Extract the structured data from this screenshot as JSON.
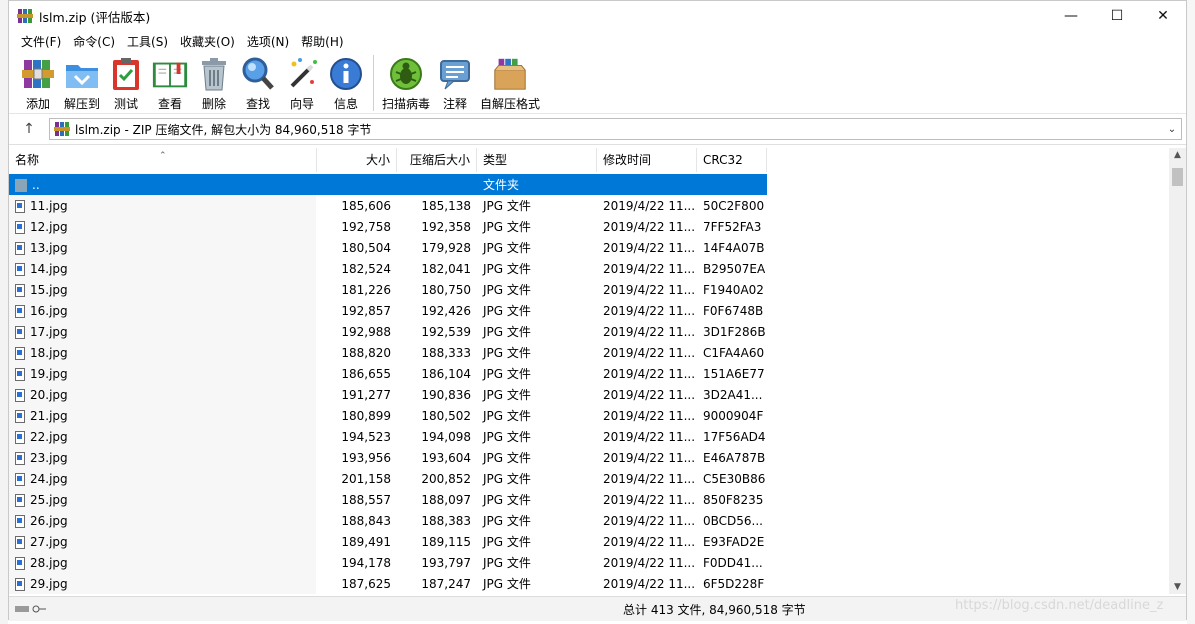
{
  "title": "lslm.zip (评估版本)",
  "window_controls": [
    "—",
    "☐",
    "✕"
  ],
  "menu": [
    "文件(F)",
    "命令(C)",
    "工具(S)",
    "收藏夹(O)",
    "选项(N)",
    "帮助(H)"
  ],
  "toolbar": [
    {
      "label": "添加",
      "icon": "add-archive-icon"
    },
    {
      "label": "解压到",
      "icon": "extract-folder-icon"
    },
    {
      "label": "测试",
      "icon": "test-clipboard-icon"
    },
    {
      "label": "查看",
      "icon": "view-book-icon"
    },
    {
      "label": "删除",
      "icon": "trash-icon"
    },
    {
      "label": "查找",
      "icon": "magnifier-icon"
    },
    {
      "label": "向导",
      "icon": "wizard-wand-icon"
    },
    {
      "label": "信息",
      "icon": "info-icon"
    },
    {
      "label": "扫描病毒",
      "icon": "virus-scan-icon"
    },
    {
      "label": "注释",
      "icon": "comment-icon"
    },
    {
      "label": "自解压格式",
      "icon": "sfx-box-icon"
    }
  ],
  "address": {
    "up": "↑",
    "text": "lslm.zip - ZIP 压缩文件, 解包大小为 84,960,518 字节",
    "dropdown": "⌄"
  },
  "columns": [
    "名称",
    "大小",
    "压缩后大小",
    "类型",
    "修改时间",
    "CRC32"
  ],
  "folder_row": {
    "name": "..",
    "type": "文件夹"
  },
  "files": [
    {
      "name": "11.jpg",
      "size": "185,606",
      "packed": "185,138",
      "type": "JPG 文件",
      "modified": "2019/4/22 11...",
      "crc": "50C2F800"
    },
    {
      "name": "12.jpg",
      "size": "192,758",
      "packed": "192,358",
      "type": "JPG 文件",
      "modified": "2019/4/22 11...",
      "crc": "7FF52FA3"
    },
    {
      "name": "13.jpg",
      "size": "180,504",
      "packed": "179,928",
      "type": "JPG 文件",
      "modified": "2019/4/22 11...",
      "crc": "14F4A07B"
    },
    {
      "name": "14.jpg",
      "size": "182,524",
      "packed": "182,041",
      "type": "JPG 文件",
      "modified": "2019/4/22 11...",
      "crc": "B29507EA"
    },
    {
      "name": "15.jpg",
      "size": "181,226",
      "packed": "180,750",
      "type": "JPG 文件",
      "modified": "2019/4/22 11...",
      "crc": "F1940A02"
    },
    {
      "name": "16.jpg",
      "size": "192,857",
      "packed": "192,426",
      "type": "JPG 文件",
      "modified": "2019/4/22 11...",
      "crc": "F0F6748B"
    },
    {
      "name": "17.jpg",
      "size": "192,988",
      "packed": "192,539",
      "type": "JPG 文件",
      "modified": "2019/4/22 11...",
      "crc": "3D1F286B"
    },
    {
      "name": "18.jpg",
      "size": "188,820",
      "packed": "188,333",
      "type": "JPG 文件",
      "modified": "2019/4/22 11...",
      "crc": "C1FA4A60"
    },
    {
      "name": "19.jpg",
      "size": "186,655",
      "packed": "186,104",
      "type": "JPG 文件",
      "modified": "2019/4/22 11...",
      "crc": "151A6E77"
    },
    {
      "name": "20.jpg",
      "size": "191,277",
      "packed": "190,836",
      "type": "JPG 文件",
      "modified": "2019/4/22 11...",
      "crc": "3D2A41..."
    },
    {
      "name": "21.jpg",
      "size": "180,899",
      "packed": "180,502",
      "type": "JPG 文件",
      "modified": "2019/4/22 11...",
      "crc": "9000904F"
    },
    {
      "name": "22.jpg",
      "size": "194,523",
      "packed": "194,098",
      "type": "JPG 文件",
      "modified": "2019/4/22 11...",
      "crc": "17F56AD4"
    },
    {
      "name": "23.jpg",
      "size": "193,956",
      "packed": "193,604",
      "type": "JPG 文件",
      "modified": "2019/4/22 11...",
      "crc": "E46A787B"
    },
    {
      "name": "24.jpg",
      "size": "201,158",
      "packed": "200,852",
      "type": "JPG 文件",
      "modified": "2019/4/22 11...",
      "crc": "C5E30B86"
    },
    {
      "name": "25.jpg",
      "size": "188,557",
      "packed": "188,097",
      "type": "JPG 文件",
      "modified": "2019/4/22 11...",
      "crc": "850F8235"
    },
    {
      "name": "26.jpg",
      "size": "188,843",
      "packed": "188,383",
      "type": "JPG 文件",
      "modified": "2019/4/22 11...",
      "crc": "0BCD56..."
    },
    {
      "name": "27.jpg",
      "size": "189,491",
      "packed": "189,115",
      "type": "JPG 文件",
      "modified": "2019/4/22 11...",
      "crc": "E93FAD2E"
    },
    {
      "name": "28.jpg",
      "size": "194,178",
      "packed": "193,797",
      "type": "JPG 文件",
      "modified": "2019/4/22 11...",
      "crc": "F0DD41..."
    },
    {
      "name": "29.jpg",
      "size": "187,625",
      "packed": "187,247",
      "type": "JPG 文件",
      "modified": "2019/4/22 11...",
      "crc": "6F5D228F"
    }
  ],
  "status": {
    "summary": "总计 413 文件, 84,960,518 字节"
  },
  "watermark": "https://blog.csdn.net/deadline_z",
  "colors": {
    "selection": "#0078d7"
  }
}
